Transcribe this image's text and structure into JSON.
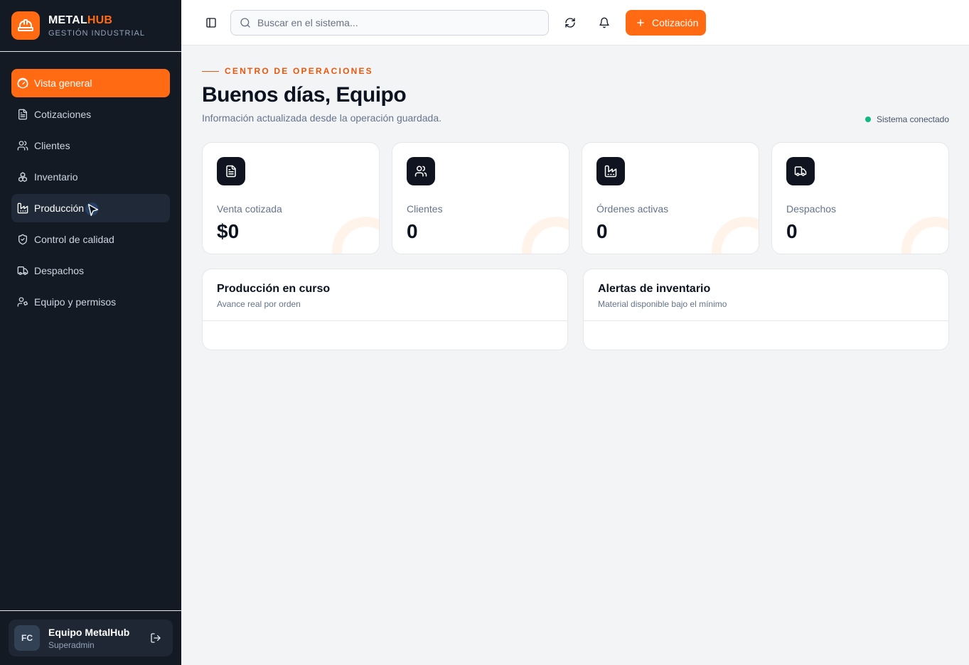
{
  "brand": {
    "name_main": "METAL",
    "name_accent": "HUB",
    "subtitle": "GESTIÓN INDUSTRIAL",
    "logo_icon": "hard-hat-icon",
    "accent_color": "#ff6a13"
  },
  "sidebar": {
    "items": [
      {
        "label": "Vista general",
        "icon": "gauge-icon",
        "state": "active"
      },
      {
        "label": "Cotizaciones",
        "icon": "file-text-icon",
        "state": "normal"
      },
      {
        "label": "Clientes",
        "icon": "users-icon",
        "state": "normal"
      },
      {
        "label": "Inventario",
        "icon": "boxes-icon",
        "state": "normal"
      },
      {
        "label": "Producción",
        "icon": "factory-icon",
        "state": "hover"
      },
      {
        "label": "Control de calidad",
        "icon": "shield-check-icon",
        "state": "normal"
      },
      {
        "label": "Despachos",
        "icon": "truck-icon",
        "state": "normal"
      },
      {
        "label": "Equipo y permisos",
        "icon": "user-cog-icon",
        "state": "normal"
      }
    ]
  },
  "user": {
    "initials": "FC",
    "name": "Equipo MetalHub",
    "role": "Superadmin"
  },
  "topbar": {
    "search_placeholder": "Buscar en el sistema...",
    "primary_button_label": "Cotización"
  },
  "header": {
    "eyebrow": "CENTRO DE OPERACIONES",
    "title": "Buenos días, Equipo",
    "subtitle": "Información actualizada desde la operación guardada.",
    "status": "Sistema conectado",
    "status_color": "#10b981"
  },
  "stats": [
    {
      "label": "Venta cotizada",
      "value": "$0",
      "icon": "file-text-icon"
    },
    {
      "label": "Clientes",
      "value": "0",
      "icon": "users-icon"
    },
    {
      "label": "Órdenes activas",
      "value": "0",
      "icon": "factory-icon"
    },
    {
      "label": "Despachos",
      "value": "0",
      "icon": "truck-icon"
    }
  ],
  "panels": [
    {
      "title": "Producción en curso",
      "subtitle": "Avance real por orden"
    },
    {
      "title": "Alertas de inventario",
      "subtitle": "Material disponible bajo el mínimo"
    }
  ]
}
